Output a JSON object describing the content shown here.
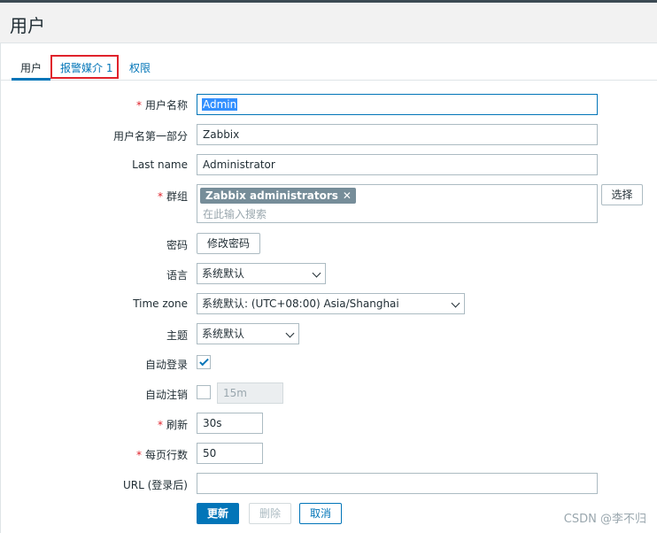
{
  "page": {
    "title": "用户"
  },
  "tabs": [
    {
      "label": "用户",
      "active": true
    },
    {
      "label": "报警媒介 1",
      "active": false
    },
    {
      "label": "权限",
      "active": false
    }
  ],
  "form": {
    "username": {
      "label": "用户名称",
      "value": "Admin"
    },
    "name": {
      "label": "用户名第一部分",
      "value": "Zabbix"
    },
    "lastname": {
      "label": "Last name",
      "value": "Administrator"
    },
    "groups": {
      "label": "群组",
      "chip": "Zabbix administrators",
      "placeholder": "在此输入搜索",
      "select_label": "选择"
    },
    "password": {
      "label": "密码",
      "button": "修改密码"
    },
    "language": {
      "label": "语言",
      "value": "系统默认"
    },
    "timezone": {
      "label": "Time zone",
      "value": "系统默认: (UTC+08:00) Asia/Shanghai"
    },
    "theme": {
      "label": "主题",
      "value": "系统默认"
    },
    "autologin": {
      "label": "自动登录",
      "checked": true
    },
    "autologout": {
      "label": "自动注销",
      "checked": false,
      "value": "15m"
    },
    "refresh": {
      "label": "刷新",
      "value": "30s"
    },
    "rows_per_page": {
      "label": "每页行数",
      "value": "50"
    },
    "url": {
      "label": "URL (登录后)",
      "value": ""
    }
  },
  "actions": {
    "update": "更新",
    "delete": "删除",
    "cancel": "取消"
  },
  "watermark": "CSDN @李不归",
  "colors": {
    "accent": "#0275b8",
    "required": "#e0222b",
    "chip": "#768d99"
  }
}
